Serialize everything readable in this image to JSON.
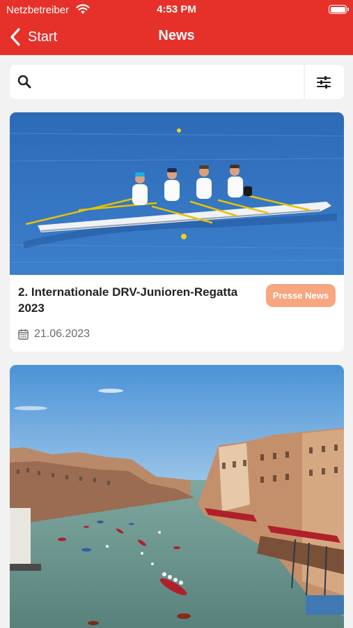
{
  "status_bar": {
    "carrier": "Netzbetreiber",
    "time": "4:53 PM",
    "wifi_icon": "wifi-icon",
    "battery_icon": "battery-icon"
  },
  "nav": {
    "back_label": "Start",
    "title": "News",
    "back_icon": "chevron-left-icon"
  },
  "search": {
    "value": "",
    "placeholder": "",
    "search_icon": "search-icon",
    "filter_icon": "sliders-icon"
  },
  "news": [
    {
      "title": "2. Internationale DRV-Junioren-Regatta 2023",
      "tag": "Presse News",
      "date": "21.06.2023",
      "image": "rowing quad on water"
    },
    {
      "title": "",
      "tag": "",
      "date": "",
      "image": "Venice Grand Canal regatta"
    }
  ],
  "colors": {
    "primary": "#e5312a",
    "badge": "#f7a680",
    "background": "#f2f2f2"
  }
}
